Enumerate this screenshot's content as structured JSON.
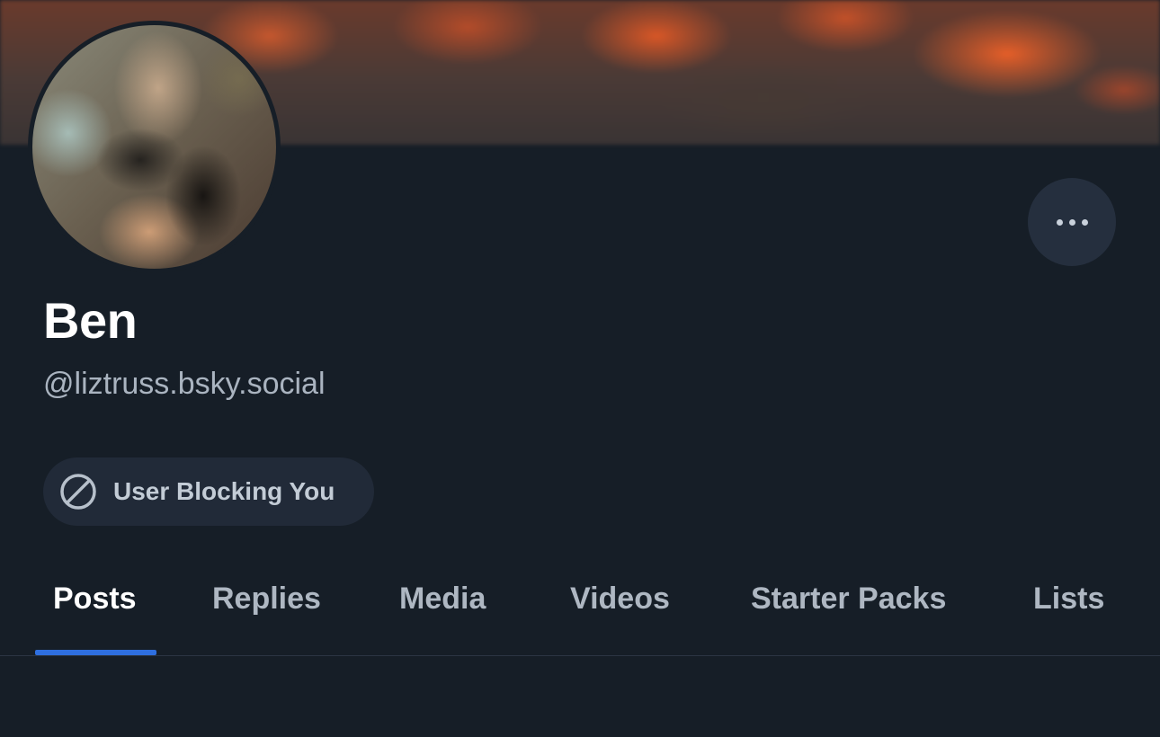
{
  "profile": {
    "display_name": "Ben",
    "handle": "@liztruss.bsky.social",
    "avatar_icon": "user-avatar",
    "banner_icon": "profile-banner"
  },
  "actions": {
    "more_icon": "more-horizontal-icon"
  },
  "status": {
    "blocking_label": "User Blocking You",
    "blocking_icon": "ban-icon"
  },
  "tabs": [
    {
      "label": "Posts",
      "active": true
    },
    {
      "label": "Replies",
      "active": false
    },
    {
      "label": "Media",
      "active": false
    },
    {
      "label": "Videos",
      "active": false
    },
    {
      "label": "Starter Packs",
      "active": false
    },
    {
      "label": "Lists",
      "active": false
    }
  ],
  "colors": {
    "background": "#161e27",
    "accent": "#2e6fe0",
    "pill_background": "#212a38",
    "text_primary": "#ffffff",
    "text_secondary": "#aab4c0"
  }
}
